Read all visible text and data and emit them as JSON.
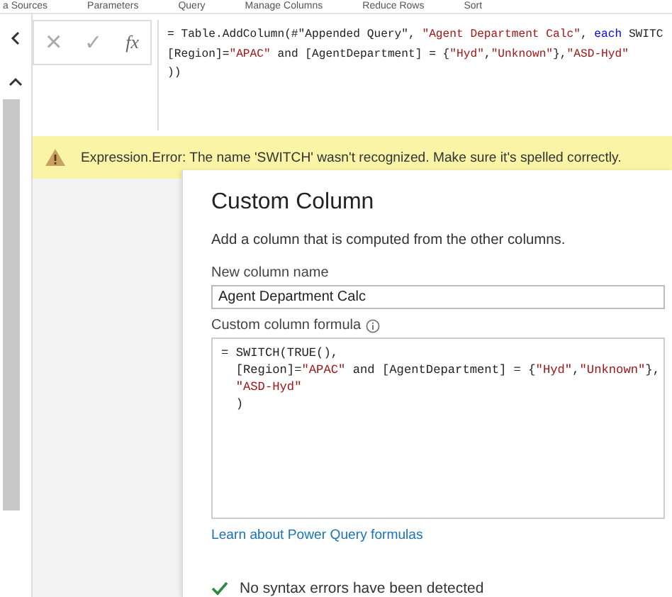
{
  "ribbon": {
    "groups": [
      "a Sources",
      "Parameters",
      "Query",
      "Manage Columns",
      "Reduce Rows",
      "Sort"
    ]
  },
  "formula_bar": {
    "buttons": [
      {
        "kind": "cancel",
        "label": "×"
      },
      {
        "kind": "confirm",
        "label": "✓"
      },
      {
        "kind": "fx",
        "label": "fx"
      }
    ],
    "lines": [
      [
        {
          "kind": "plain",
          "text": "= Table.AddColumn(#\"Appended Query\", "
        },
        {
          "kind": "string",
          "text": "\"Agent Department Calc\""
        },
        {
          "kind": "plain",
          "text": ", "
        },
        {
          "kind": "keyword",
          "text": "each"
        },
        {
          "kind": "plain",
          "text": " SWITC"
        }
      ],
      [
        {
          "kind": "plain",
          "text": "[Region]="
        },
        {
          "kind": "string",
          "text": "\"APAC\""
        },
        {
          "kind": "plain",
          "text": " and [AgentDepartment] = {"
        },
        {
          "kind": "string",
          "text": "\"Hyd\""
        },
        {
          "kind": "plain",
          "text": ","
        },
        {
          "kind": "string",
          "text": "\"Unknown\""
        },
        {
          "kind": "plain",
          "text": "},"
        },
        {
          "kind": "string",
          "text": "\"ASD-Hyd\""
        }
      ],
      [
        {
          "kind": "plain",
          "text": "))"
        }
      ]
    ]
  },
  "error": {
    "message": "Expression.Error: The name 'SWITCH' wasn't recognized.  Make sure it's spelled correctly."
  },
  "dialog": {
    "title": "Custom Column",
    "description": "Add a column that is computed from the other columns.",
    "name_label": "New column name",
    "name_value": "Agent Department Calc",
    "formula_label": "Custom column formula",
    "formula_lines": [
      [
        {
          "kind": "plain",
          "text": "= SWITCH(TRUE(),"
        }
      ],
      [
        {
          "kind": "plain",
          "text": "  [Region]="
        },
        {
          "kind": "string",
          "text": "\"APAC\""
        },
        {
          "kind": "plain",
          "text": " and [AgentDepartment] = {"
        },
        {
          "kind": "string",
          "text": "\"Hyd\""
        },
        {
          "kind": "plain",
          "text": ","
        },
        {
          "kind": "string",
          "text": "\"Unknown\""
        },
        {
          "kind": "plain",
          "text": "},"
        }
      ],
      [
        {
          "kind": "string",
          "text": "  \"ASD-Hyd\""
        }
      ],
      [
        {
          "kind": "plain",
          "text": "  )"
        }
      ]
    ],
    "link": "Learn about Power Query formulas",
    "status": "No syntax errors have been detected"
  }
}
